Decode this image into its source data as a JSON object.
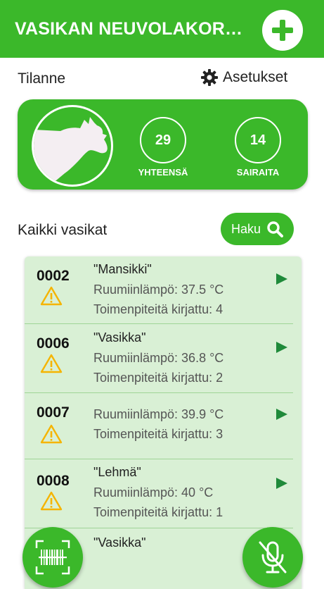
{
  "appbar": {
    "title": "VASIKAN NEUVOLAKORTTI",
    "add_icon": "plus-icon"
  },
  "status": {
    "heading": "Tilanne",
    "settings_label": "Asetukset",
    "total_value": "29",
    "total_label": "YHTEENSÄ",
    "sick_value": "14",
    "sick_label": "SAIRAITA"
  },
  "list": {
    "heading": "Kaikki vasikat",
    "search_label": "Haku",
    "calves": [
      {
        "id": "0002",
        "name": "\"Mansikki\"",
        "temp": "Ruumiinlämpö: 37.5 °C",
        "procedures": "Toimenpiteitä kirjattu: 4"
      },
      {
        "id": "0006",
        "name": "\"Vasikka\"",
        "temp": "Ruumiinlämpö: 36.8 °C",
        "procedures": "Toimenpiteitä kirjattu: 2"
      },
      {
        "id": "0007",
        "name": "",
        "temp": "Ruumiinlämpö: 39.9 °C",
        "procedures": "Toimenpiteitä kirjattu: 3"
      },
      {
        "id": "0008",
        "name": "\"Lehmä\"",
        "temp": "Ruumiinlämpö: 40 °C",
        "procedures": "Toimenpiteitä kirjattu: 1"
      },
      {
        "id": "",
        "name": "\"Vasikka\"",
        "temp": "",
        "procedures": ""
      }
    ]
  },
  "fabs": {
    "scan_icon": "barcode-scanner-icon",
    "voice_icon": "microphone-off-icon"
  },
  "colors": {
    "primary_green": "#3bb82a",
    "list_bg": "#d9f0d5",
    "arrow_green": "#1f8a3a",
    "warning_yellow": "#f5b400"
  }
}
